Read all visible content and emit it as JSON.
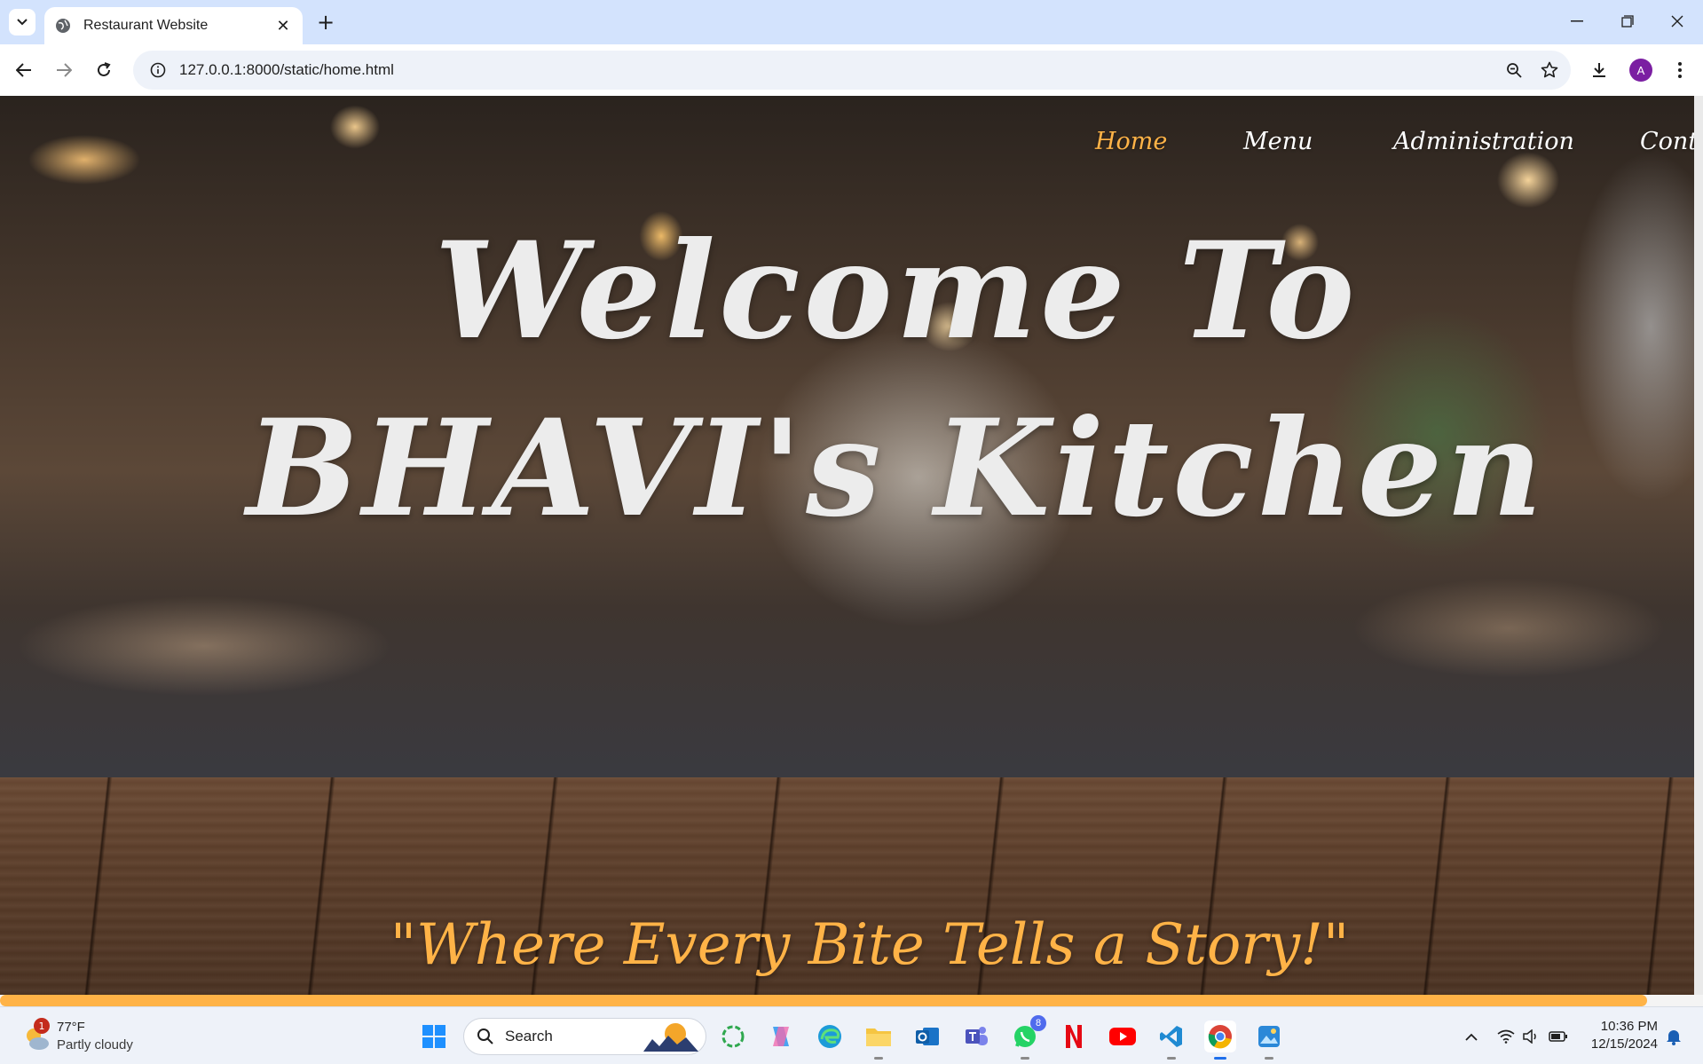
{
  "browser": {
    "tab_title": "Restaurant Website",
    "url": "127.0.0.1:8000/static/home.html",
    "profile_initial": "A"
  },
  "site": {
    "nav": [
      {
        "label": "Home",
        "active": true
      },
      {
        "label": "Menu",
        "active": false
      },
      {
        "label": "Administration",
        "active": false
      },
      {
        "label": "Conta",
        "active": false
      }
    ],
    "hero_title": "Welcome To BHAVI's Kitchen",
    "tagline": "\"Where Every Bite Tells a Story!\"",
    "accent_color": "#ffb347"
  },
  "taskbar": {
    "weather_temp": "77°F",
    "weather_condition": "Partly cloudy",
    "weather_badge": "1",
    "search_label": "Search",
    "whatsapp_badge": "8",
    "time": "10:36 PM",
    "date": "12/15/2024"
  }
}
